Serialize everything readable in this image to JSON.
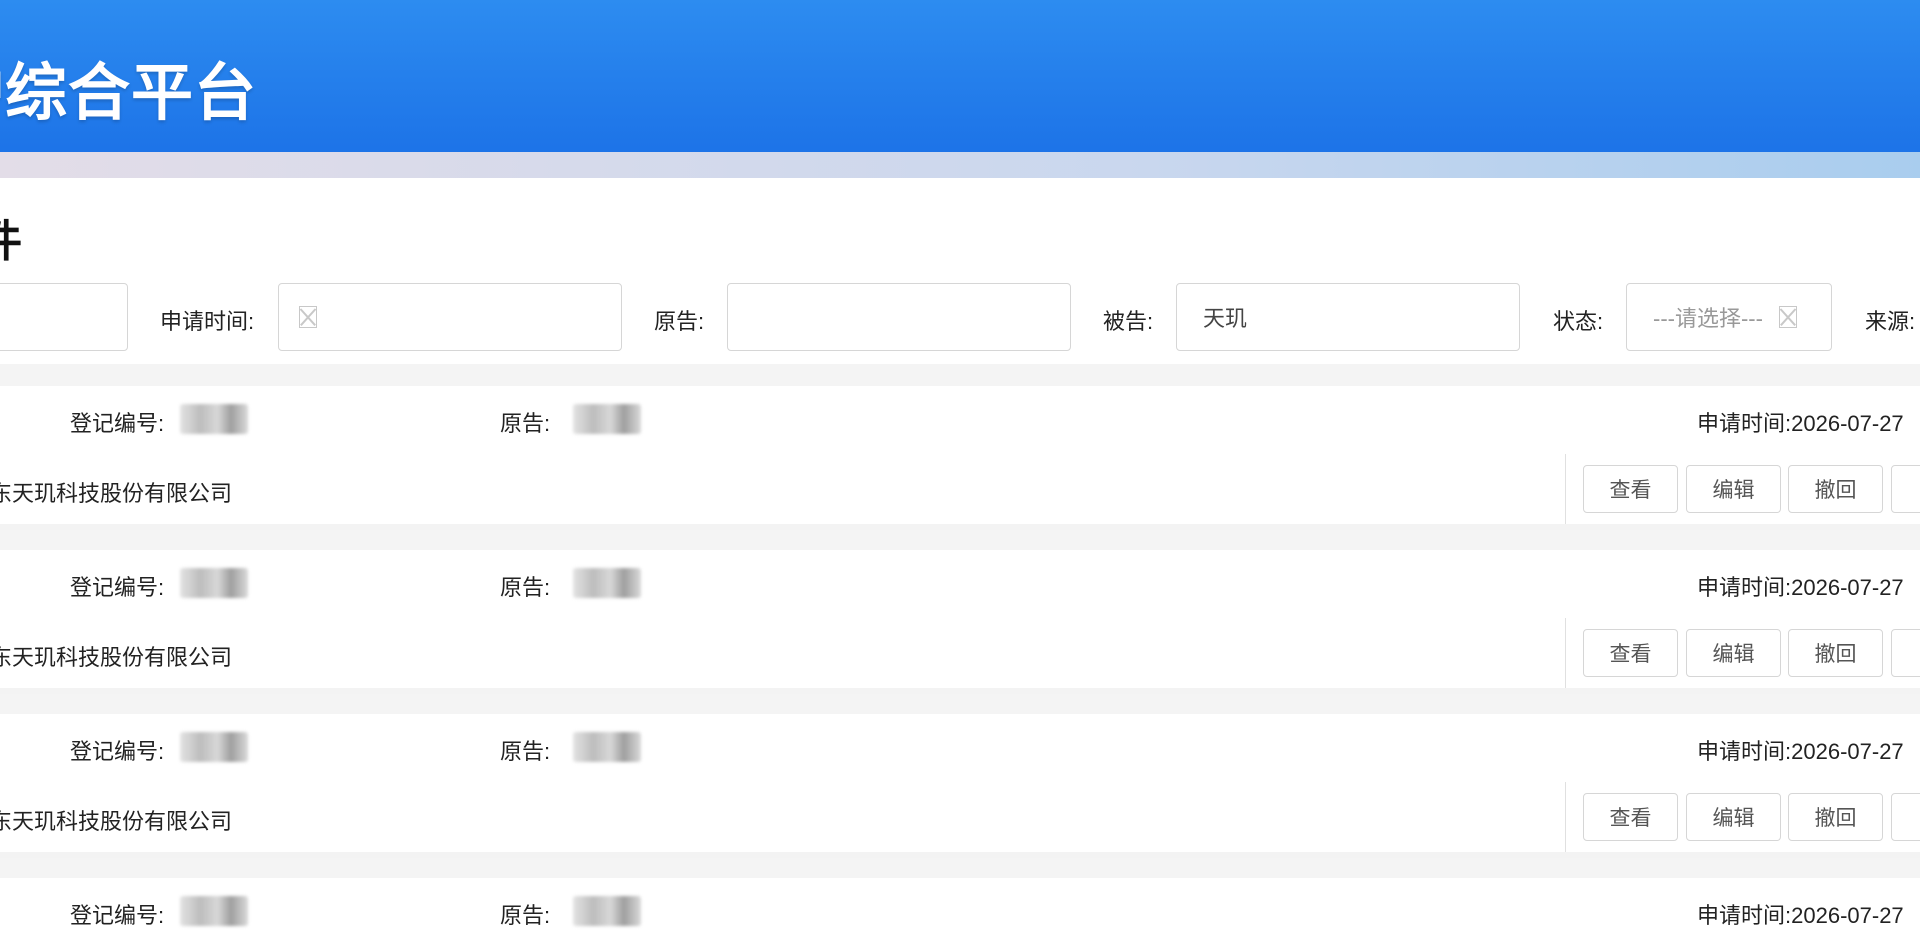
{
  "header": {
    "title": "护综合平台"
  },
  "page": {
    "title": "件"
  },
  "filters": {
    "apply_time_label": "申请时间:",
    "plaintiff_label": "原告:",
    "defendant_label": "被告:",
    "defendant_value": "天玑",
    "status_label": "状态:",
    "status_placeholder": "---请选择---",
    "source_label": "来源:"
  },
  "records": [
    {
      "reg_label": "登记编号:",
      "plaintiff_label": "原告:",
      "time_label": "申请时间:",
      "time_value": "2026-07-27",
      "defendant": "东天玑科技股份有限公司",
      "actions": [
        "查看",
        "编辑",
        "撤回"
      ]
    },
    {
      "reg_label": "登记编号:",
      "plaintiff_label": "原告:",
      "time_label": "申请时间:",
      "time_value": "2026-07-27",
      "defendant": "东天玑科技股份有限公司",
      "actions": [
        "查看",
        "编辑",
        "撤回"
      ]
    },
    {
      "reg_label": "登记编号:",
      "plaintiff_label": "原告:",
      "time_label": "申请时间:",
      "time_value": "2026-07-27",
      "defendant": "东天玑科技股份有限公司",
      "actions": [
        "查看",
        "编辑",
        "撤回"
      ]
    },
    {
      "reg_label": "登记编号:",
      "plaintiff_label": "原告:",
      "time_label": "申请时间:",
      "time_value": "2026-07-27"
    }
  ],
  "colors": {
    "header_blue": "#1a6fe6",
    "border": "#d6d6d6"
  },
  "icons": {
    "date_picker": "date-icon",
    "select": "select-arrow-icon"
  }
}
